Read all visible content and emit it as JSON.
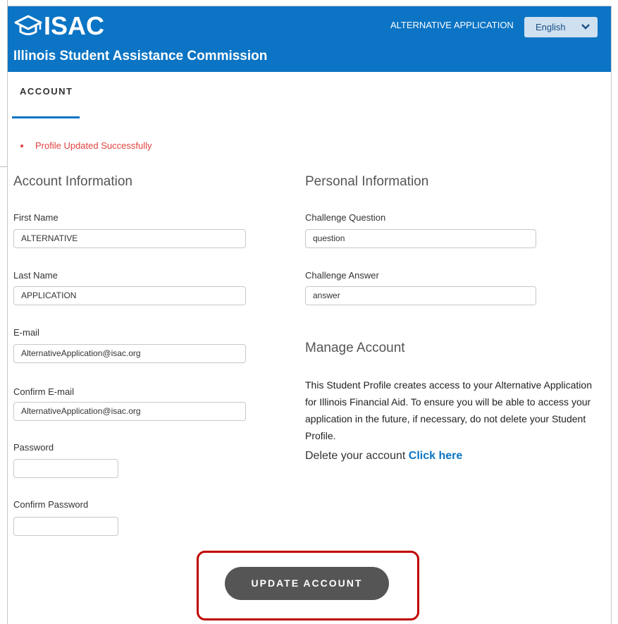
{
  "header": {
    "logo_text": "ISAC",
    "org_name": "Illinois Student Assistance Commission",
    "alt_app_link": "ALTERNATIVE APPLICATION",
    "language_selected": "English",
    "bg_color": "#0b74c4"
  },
  "tabs": [
    {
      "label": "ACCOUNT",
      "active": true
    }
  ],
  "status_message": "Profile Updated Successfully",
  "account_info": {
    "title": "Account Information",
    "fields": {
      "first_name": {
        "label": "First Name",
        "value": "ALTERNATIVE"
      },
      "last_name": {
        "label": "Last Name",
        "value": "APPLICATION"
      },
      "email": {
        "label": "E-mail",
        "value": "AlternativeApplication@isac.org"
      },
      "confirm_email": {
        "label": "Confirm E-mail",
        "value": "AlternativeApplication@isac.org"
      },
      "password": {
        "label": "Password",
        "value": ""
      },
      "confirm_password": {
        "label": "Confirm Password",
        "value": ""
      }
    }
  },
  "personal_info": {
    "title": "Personal Information",
    "fields": {
      "challenge_question": {
        "label": "Challenge Question",
        "value": "question"
      },
      "challenge_answer": {
        "label": "Challenge Answer",
        "value": "answer"
      }
    }
  },
  "manage_account": {
    "title": "Manage Account",
    "text": "This Student Profile creates access to your Alternative Application for Illinois Financial Aid. To ensure you will be able to access your application in the future, if necessary, do not delete your Student Profile.",
    "delete_prefix": "Delete your account",
    "delete_link": "Click here"
  },
  "update_button": "UPDATE ACCOUNT",
  "colors": {
    "accent": "#0b74c4",
    "error": "#e0433f",
    "button": "#555555",
    "highlight": "#c00000"
  }
}
